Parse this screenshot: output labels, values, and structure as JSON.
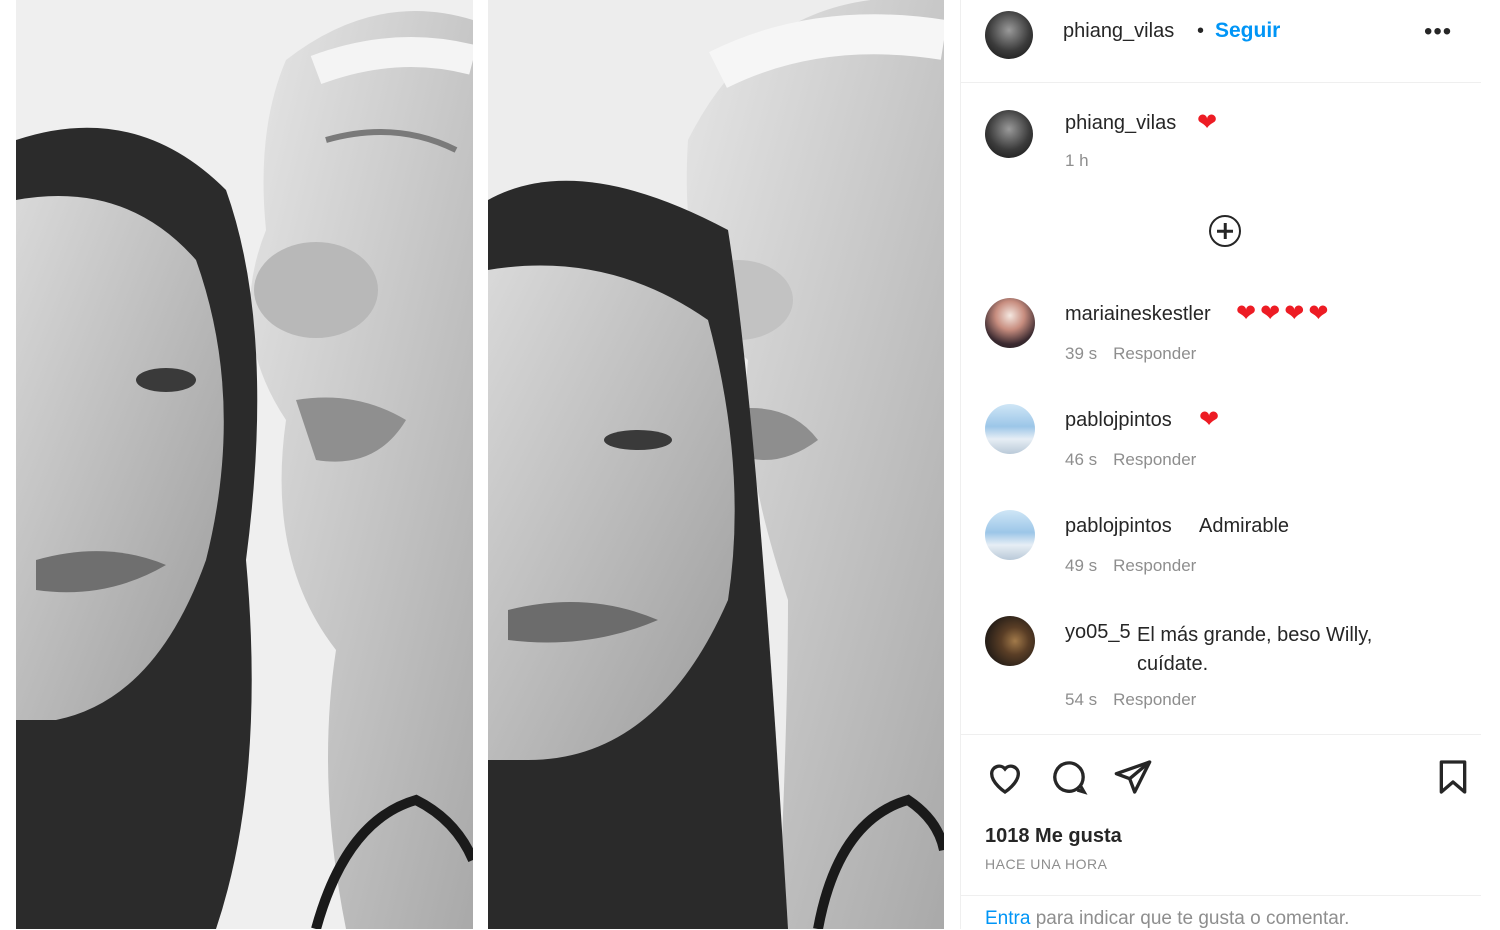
{
  "post": {
    "username": "phiang_vilas",
    "separator": "•",
    "follow_label": "Seguir",
    "more_label": "•••"
  },
  "caption": {
    "username": "phiang_vilas",
    "emoji": "❤",
    "time": "1 h"
  },
  "comments": [
    {
      "username": "mariaineskestler",
      "text": "❤❤❤❤",
      "time": "39 s",
      "reply": "Responder"
    },
    {
      "username": "pablojpintos",
      "text": "❤",
      "time": "46 s",
      "reply": "Responder"
    },
    {
      "username": "pablojpintos",
      "text": "Admirable",
      "time": "49 s",
      "reply": "Responder"
    },
    {
      "username": "yo05_5",
      "text": "El más grande, beso Willy, cuídate.",
      "time": "54 s",
      "reply": "Responder"
    }
  ],
  "stats": {
    "likes": "1018 Me gusta",
    "posted": "HACE UNA HORA"
  },
  "login": {
    "link": "Entra",
    "text": " para indicar que te gusta o comentar."
  },
  "colors": {
    "accent": "#0095f6",
    "heart": "#ed1c24",
    "muted": "#8e8e8e"
  },
  "icons": [
    "heart-outline-icon",
    "comment-icon",
    "share-icon",
    "bookmark-icon",
    "plus-circle-icon"
  ]
}
